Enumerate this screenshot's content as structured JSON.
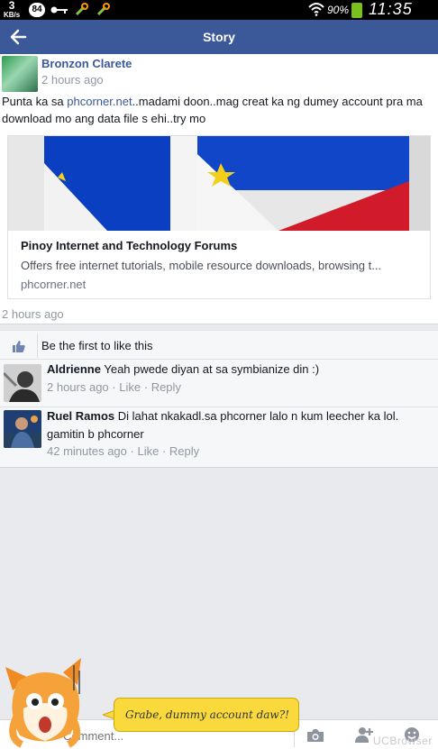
{
  "status_bar": {
    "speed_value": "3",
    "speed_unit": "KB/s",
    "notification_count": "84",
    "battery_percent": "90%",
    "time": "11:35 AM",
    "icons": [
      "key-icon",
      "tool-icon",
      "tool-icon",
      "wifi-icon",
      "battery-icon"
    ]
  },
  "header": {
    "title": "Story",
    "back_icon": "arrow-left-icon",
    "color": "#3b5998"
  },
  "post": {
    "author": "Bronzon Clarete",
    "time": "2 hours ago",
    "text_before_link": "Punta ka sa ",
    "link_text": "phcorner.net",
    "text_after_link": "..madami doon..mag creat ka ng dumey account pra ma download mo ang data file s ehi..try mo",
    "attachment": {
      "title": "Pinoy Internet and Technology Forums",
      "description": "Offers free internet tutorials, mobile resource downloads, browsing t...",
      "domain": "phcorner.net"
    },
    "footer_time": "2 hours ago"
  },
  "likes": {
    "text": "Be the first to like this",
    "icon": "thumbs-up-icon"
  },
  "comments": [
    {
      "name": "Aldrienne",
      "text": "Yeah pwede diyan at sa symbianize din :)",
      "time": "2 hours ago",
      "like_label": "Like",
      "reply_label": "Reply"
    },
    {
      "name": "Ruel Ramos",
      "text": "Di lahat nkakadl.sa phcorner lalo n kum leecher ka lol. gamitin b phcorner",
      "time": "42 minutes ago",
      "like_label": "Like",
      "reply_label": "Reply"
    }
  ],
  "composer": {
    "placeholder": "Comment...",
    "icons": [
      "camera-icon",
      "tag-friend-icon",
      "emoji-icon"
    ]
  },
  "overlay": {
    "bubble_text": "Grabe, dummy account daw?!",
    "watermark": "UCBrowser"
  }
}
